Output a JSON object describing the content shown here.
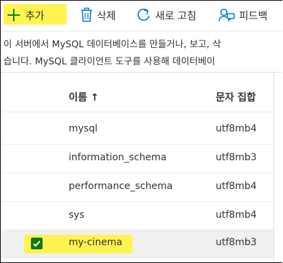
{
  "toolbar": {
    "add_label": "추가",
    "delete_label": "삭제",
    "refresh_label": "새로 고침",
    "feedback_label": "피드백"
  },
  "description": {
    "line1": "이 서버에서 MySQL 데이터베이스를 만들거나, 보고, 삭",
    "line2": "습니다. MySQL 클라이언트 도구를 사용해 데이터베이"
  },
  "table": {
    "headers": {
      "name": "이름 ↑",
      "charset": "문자 집합"
    },
    "rows": [
      {
        "name": "mysql",
        "charset": "utf8mb4",
        "selected": false
      },
      {
        "name": "information_schema",
        "charset": "utf8mb3",
        "selected": false
      },
      {
        "name": "performance_schema",
        "charset": "utf8mb4",
        "selected": false
      },
      {
        "name": "sys",
        "charset": "utf8mb4",
        "selected": false
      },
      {
        "name": "my-cinema",
        "charset": "utf8mb3",
        "selected": true
      }
    ]
  },
  "colors": {
    "highlight": "#fff44f",
    "accent": "#0078d4",
    "checkbox": "#107c10"
  },
  "icons": {
    "add": "plus-icon",
    "delete": "trash-icon",
    "refresh": "refresh-icon",
    "feedback": "feedback-icon",
    "check": "check-icon"
  }
}
